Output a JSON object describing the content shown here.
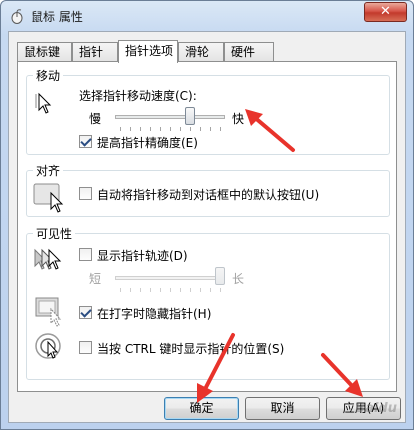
{
  "window": {
    "title": "鼠标 属性",
    "close_label": "✕"
  },
  "tabs": [
    {
      "label": "鼠标键",
      "active": false
    },
    {
      "label": "指针",
      "active": false
    },
    {
      "label": "指针选项",
      "active": true
    },
    {
      "label": "滑轮",
      "active": false
    },
    {
      "label": "硬件",
      "active": false
    }
  ],
  "motion": {
    "title": "移动",
    "speed_label": "选择指针移动速度(C):",
    "slow_label": "慢",
    "fast_label": "快",
    "speed_level": 0.7,
    "precision_label": "提高指针精确度(E)",
    "precision_checked": true
  },
  "snap": {
    "title": "对齐",
    "snap_label": "自动将指针移动到对话框中的默认按钮(U)",
    "snap_checked": false
  },
  "visibility": {
    "title": "可见性",
    "trails_label": "显示指针轨迹(D)",
    "trails_checked": false,
    "short_label": "短",
    "long_label": "长",
    "trail_level": 1.0,
    "hide_label": "在打字时隐藏指针(H)",
    "hide_checked": true,
    "ctrl_label": "当按 CTRL 键时显示指针的位置(S)",
    "ctrl_checked": false
  },
  "buttons": {
    "ok": "确定",
    "cancel": "取消",
    "apply": "应用(A)"
  },
  "watermark": "Baidu",
  "colors": {
    "annotation_arrow": "#e8332b"
  }
}
